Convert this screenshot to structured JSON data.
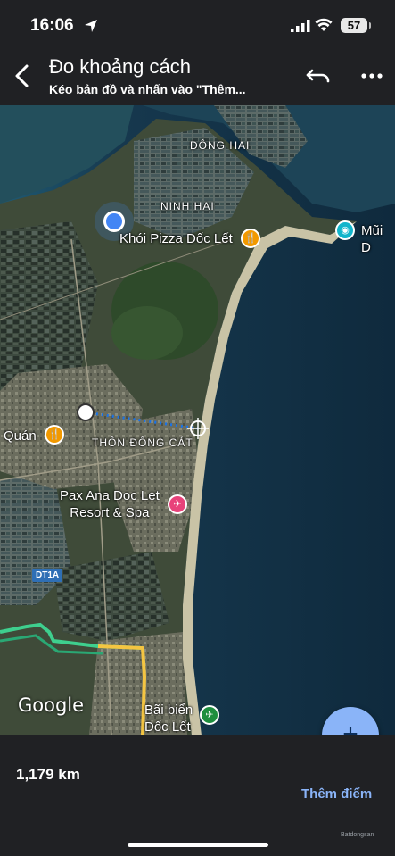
{
  "status_bar": {
    "time": "16:06",
    "battery": "57",
    "location_icon": "location-arrow-icon",
    "signal_icon": "cellular-signal-icon",
    "wifi_icon": "wifi-icon"
  },
  "header": {
    "title": "Đo khoảng cách",
    "subtitle": "Kéo bản đồ và nhấn vào \"Thêm...",
    "back_icon": "back-arrow-icon",
    "undo_icon": "undo-icon",
    "more_icon": "more-dots-icon"
  },
  "map": {
    "labels": {
      "dong_hai": "DÔNG HAI",
      "ninh_hai": "NINH HAI",
      "thon_dong_cat": "THÔN ĐÔNG CÁT",
      "road_shield": "DT1A"
    },
    "pois": {
      "khoi_pizza": "Khói Pizza Dốc Lết",
      "mui": "Mũi D",
      "quan": "Quán",
      "pax_ana_line1": "Pax Ana Doc Let",
      "pax_ana_line2": "Resort & Spa",
      "bai_bien_line1": "Bãi biển",
      "bai_bien_line2": "Dốc Lết"
    },
    "logo": "Google"
  },
  "colors": {
    "accent": "#8ab4f8",
    "background": "#202124",
    "poi_orange": "#f29900",
    "poi_pink": "#e8437a",
    "poi_green": "#1e8e3e",
    "poi_teal": "#12b5cb",
    "location_blue": "#4285f4"
  },
  "fab": {
    "label": "+",
    "icon": "plus-icon"
  },
  "bottom": {
    "distance": "1,179 km",
    "add_point": "Thêm điểm",
    "watermark": "Batdongsan"
  }
}
